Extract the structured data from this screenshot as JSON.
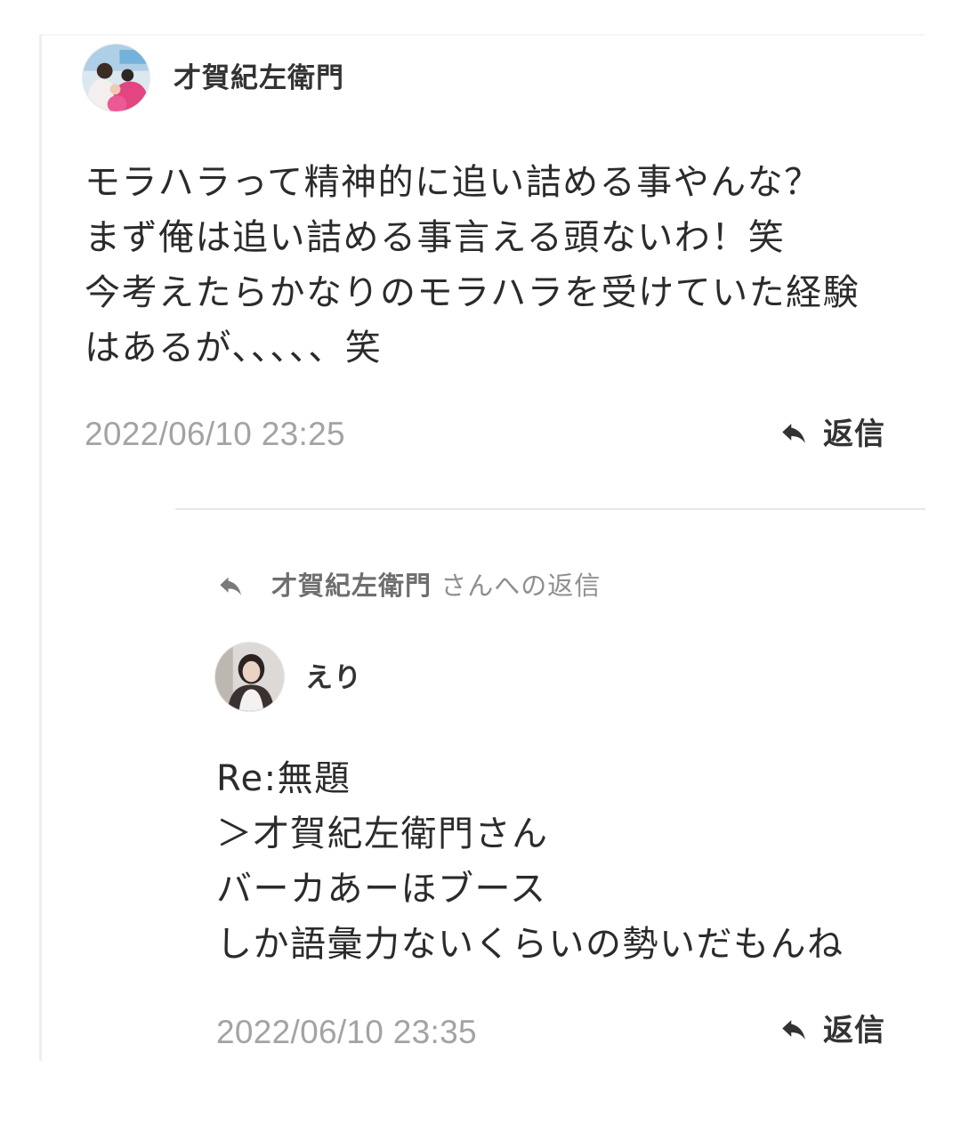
{
  "comment": {
    "username": "才賀紀左衛門",
    "avatar_icon": "user-photo",
    "body": [
      "モラハラって精神的に追い詰める事やんな？",
      "まず俺は追い詰める事言える頭ないわ！笑",
      "今考えたらかなりのモラハラを受けていた経験",
      "はあるが、、、、、笑"
    ],
    "timestamp": "2022/06/10 23:25",
    "reply_label": "返信",
    "reply_icon": "reply-arrow"
  },
  "reply": {
    "reply_to": {
      "icon": "reply-arrow",
      "name": "才賀紀左衛門",
      "suffix": "さんへの返信"
    },
    "username": "えり",
    "avatar_icon": "user-photo",
    "body": [
      "Re:無題",
      "＞才賀紀左衛門さん",
      "バーカあーほブース",
      "しか語彙力ないくらいの勢いだもんね"
    ],
    "timestamp": "2022/06/10 23:35",
    "reply_label": "返信",
    "reply_icon": "reply-arrow"
  },
  "colors": {
    "text": "#2b2b2b",
    "username": "#333333",
    "timestamp": "#a3a3a3",
    "divider": "#e8e8e8",
    "reply_to_text": "#8f8f8f"
  }
}
